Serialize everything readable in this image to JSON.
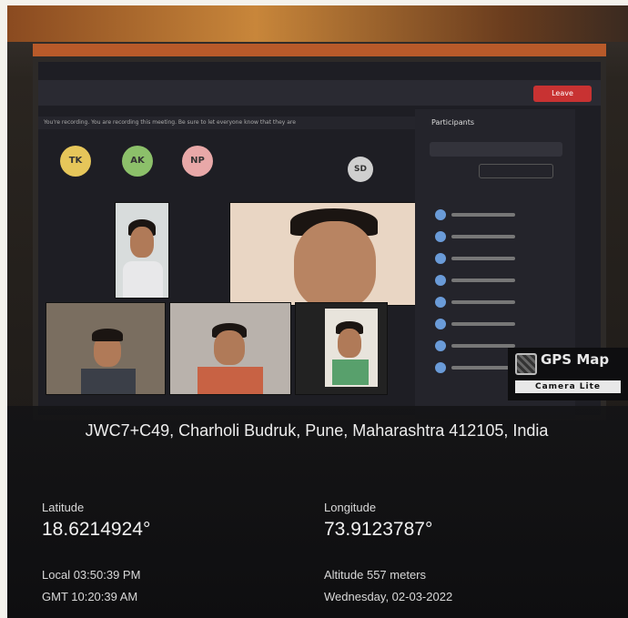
{
  "meeting": {
    "leave_label": "Leave",
    "recording_notice": "You're recording. You are recording this meeting. Be sure to let everyone know that they are",
    "participants_title": "Participants",
    "avatars": [
      {
        "initials": "TK",
        "color": "#e6c65a"
      },
      {
        "initials": "AK",
        "color": "#8cc06a"
      },
      {
        "initials": "NP",
        "color": "#e8a8a8"
      },
      {
        "initials": "SD",
        "color": "#cfcfcf"
      }
    ]
  },
  "gps_badge": {
    "title": "GPS Map",
    "subtitle": "Camera Lite"
  },
  "location": {
    "address": "JWC7+C49, Charholi Budruk, Pune, Maharashtra 412105, India",
    "latitude_label": "Latitude",
    "latitude_value": "18.6214924°",
    "longitude_label": "Longitude",
    "longitude_value": "73.9123787°",
    "local_time": "Local 03:50:39 PM",
    "gmt_time": "GMT 10:20:39 AM",
    "altitude": "Altitude 557 meters",
    "date": "Wednesday, 02-03-2022"
  }
}
